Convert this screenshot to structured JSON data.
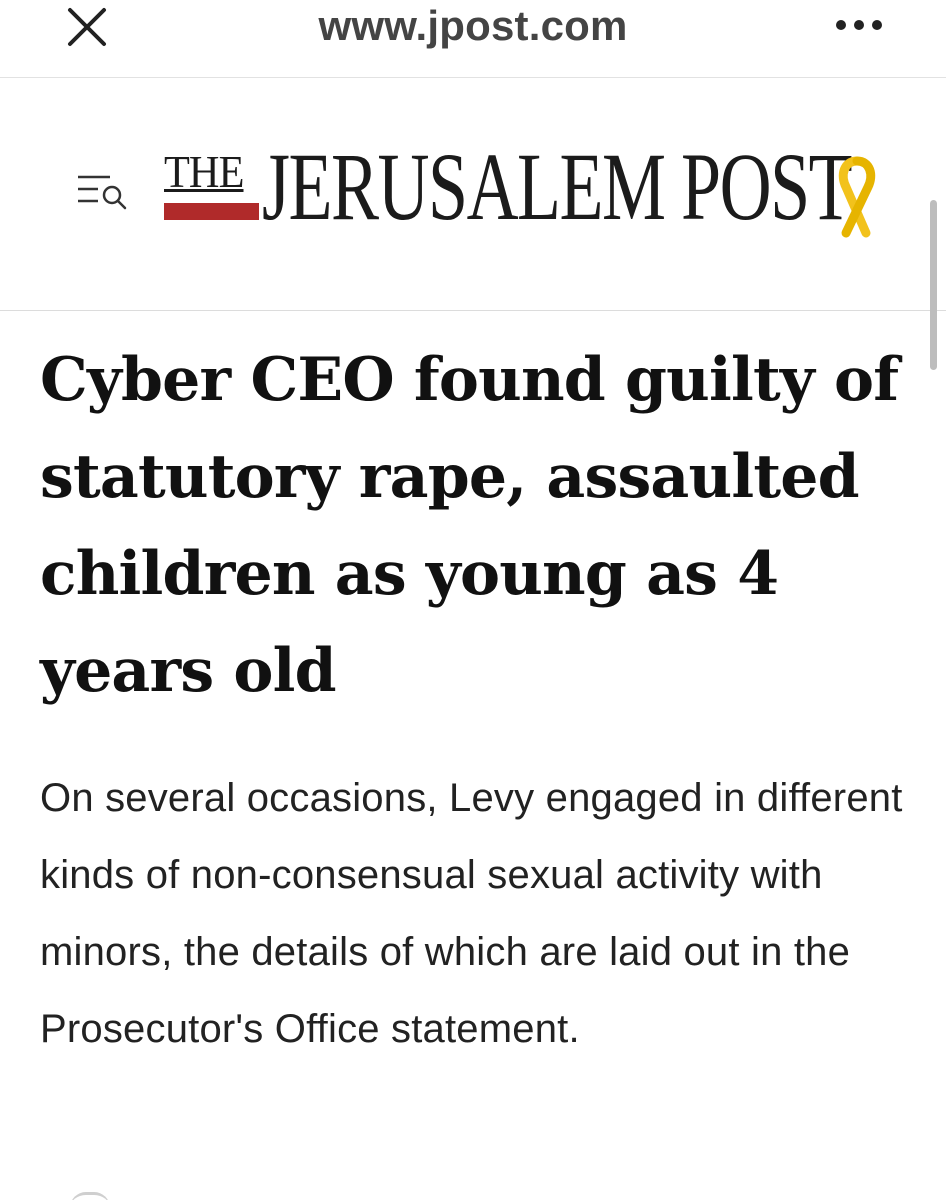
{
  "browser": {
    "url": "www.jpost.com",
    "close_icon": "close-icon",
    "more_icon": "more-icon"
  },
  "header": {
    "menu_icon": "menu-search-icon",
    "logo_the": "THE",
    "logo_main": "JERUSALEM POST",
    "ribbon_icon": "yellow-ribbon-icon",
    "colors": {
      "logo_bar": "#b02a2a",
      "ribbon": "#f2c21c"
    }
  },
  "article": {
    "headline": "Cyber CEO found guilty of statutory rape, assaulted children as young as 4 years old",
    "dek": "On several occasions, Levy engaged in different kinds of non-consensual sexual activity with minors, the details of which are laid out in the Prosecutor's Office statement."
  }
}
